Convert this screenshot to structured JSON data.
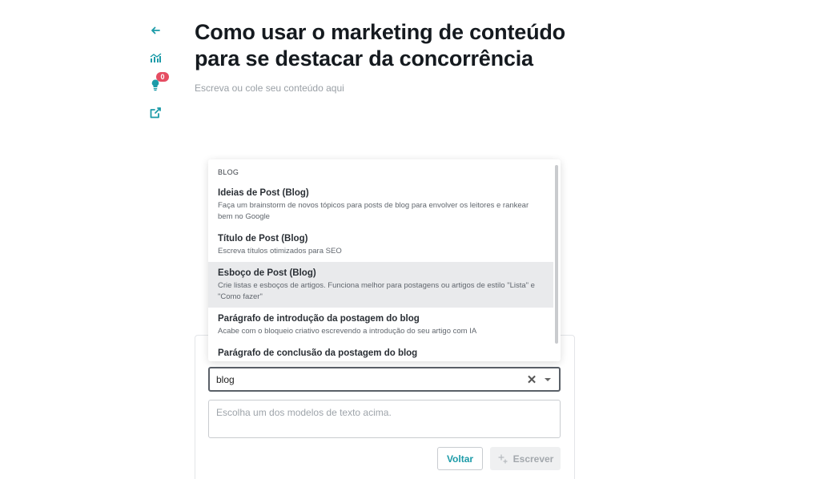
{
  "article": {
    "title": "Como usar o marketing de conteúdo para se destacar da concorrência",
    "subtitle": "Escreva ou cole seu conteúdo aqui"
  },
  "rail": {
    "back_icon": "arrow-left-icon",
    "stats_icon": "chart-icon",
    "ideas_icon": "lightbulb-icon",
    "ideas_badge": "0",
    "share_icon": "share-icon",
    "accent": "#1c9ba8"
  },
  "dropdown": {
    "group_label": "BLOG",
    "items": [
      {
        "title": "Ideias de Post (Blog)",
        "desc": "Faça um brainstorm de novos tópicos para posts de blog para envolver os leitores e rankear bem no Google"
      },
      {
        "title": "Título de Post (Blog)",
        "desc": "Escreva títulos otimizados para SEO"
      },
      {
        "title": "Esboço de Post (Blog)",
        "desc": "Crie listas e esboços de artigos. Funciona melhor para postagens ou artigos de estilo \"Lista\" e \"Como fazer\""
      },
      {
        "title": "Parágrafo de introdução da postagem do blog",
        "desc": "Acabe com o bloqueio criativo escrevendo a introdução do seu artigo com IA"
      },
      {
        "title": "Parágrafo de conclusão da postagem do blog",
        "desc": ""
      }
    ]
  },
  "form": {
    "search_value": "blog",
    "textarea_placeholder": "Escolha um dos modelos de texto acima.",
    "back_label": "Voltar",
    "write_label": "Escrever"
  }
}
